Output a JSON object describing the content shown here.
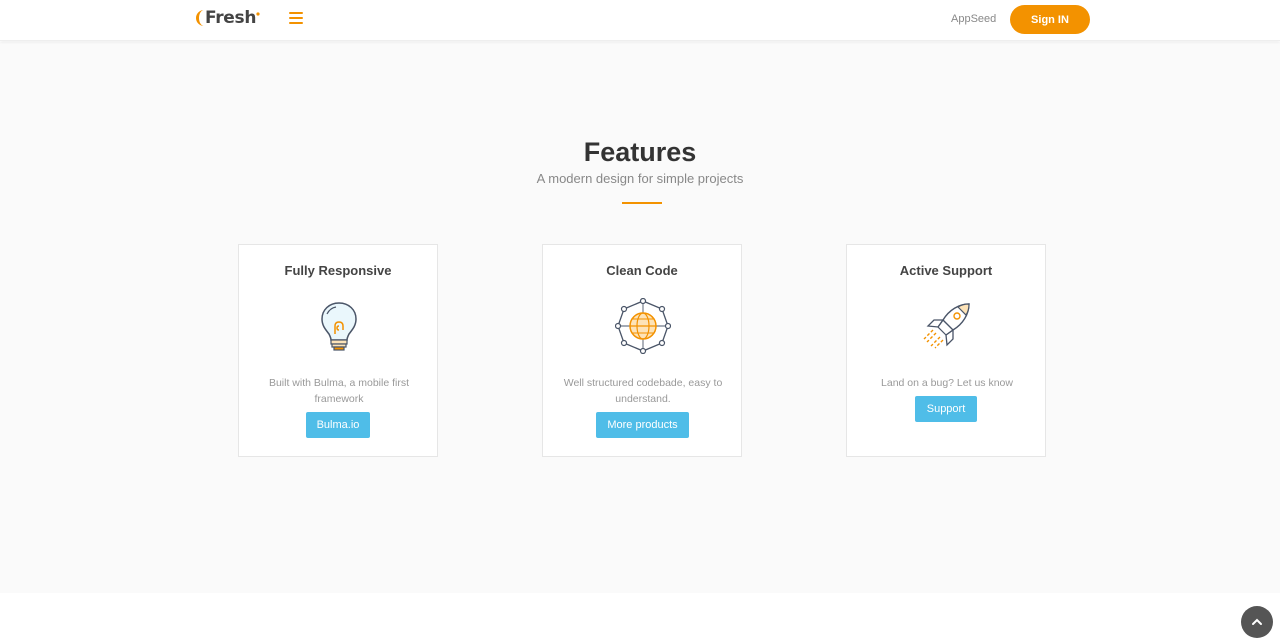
{
  "navbar": {
    "logo_text": "Fresh",
    "link_label": "AppSeed",
    "signin_label": "Sign IN",
    "accent_color": "#f39200"
  },
  "features": {
    "title": "Features",
    "subtitle": "A modern design for simple projects",
    "cards": [
      {
        "title": "Fully Responsive",
        "icon": "lightbulb-icon",
        "description": "Built with Bulma, a mobile first framework",
        "button_label": "Bulma.io"
      },
      {
        "title": "Clean Code",
        "icon": "globe-network-icon",
        "description": "Well structured codebade, easy to understand.",
        "button_label": "More products"
      },
      {
        "title": "Active Support",
        "icon": "rocket-icon",
        "description": "Land on a bug? Let us know",
        "button_label": "Support"
      }
    ]
  },
  "colors": {
    "accent": "#f39200",
    "button": "#4fbde8"
  },
  "scroll_top_icon": "chevron-up-icon"
}
